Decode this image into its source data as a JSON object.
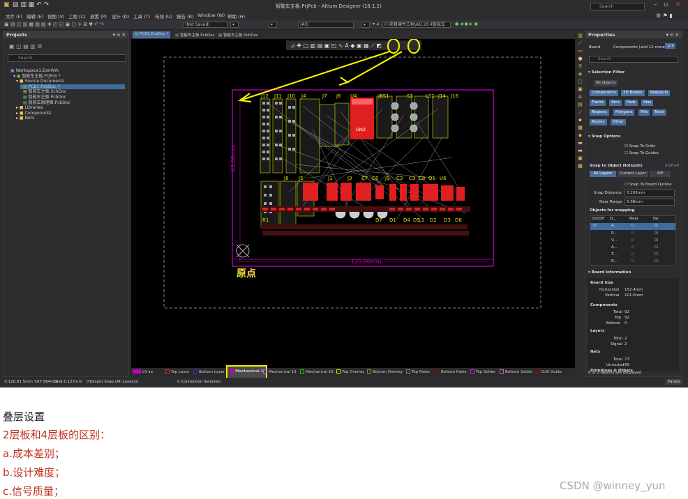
{
  "app": {
    "title": "智能车主板.PrjPcb - Altium Designer (18.1.2)",
    "search": "Search"
  },
  "menu": [
    "文件 (F)",
    "编辑 (E)",
    "视图 (V)",
    "工程 (C)",
    "放置 (P)",
    "设计 (D)",
    "工具 (T)",
    "布线 (U)",
    "报告 (R)",
    "Window (W)",
    "帮助 (H)"
  ],
  "toolbar": {
    "not_saved": "(Not Saved)",
    "all": "(All)",
    "path": "F:\\项目硬件工程\\AD 20.4智能车主板"
  },
  "projects": {
    "title": "Projects",
    "search": "Search",
    "tree": [
      "Workspace1.DsnWrk",
      "智能车主板.PrjPcb *",
      "Source Documents",
      "PCB1.PcbDoc *",
      "智能车主板.SchDoc",
      "智能车主板.PcbDoc",
      "智能车原理图.PcbDoc",
      "Libraries",
      "Components",
      "Nets"
    ]
  },
  "doc_tabs": [
    "PCB1.PcbDoc *",
    "智能车主板.PcbDoc",
    "智能车主板.SchDoc"
  ],
  "pcb": {
    "origin_label": "原点",
    "dim_h": "120.00mm",
    "dim_v": "65.00mm",
    "designators": [
      "J12",
      "J11",
      "J10",
      "J4",
      "J7",
      "J6",
      "U4",
      "JBS1",
      "S3",
      "LS1",
      "J14",
      "J16",
      "J8",
      "J5",
      "J1",
      "J3",
      "C7",
      "C6",
      "J9",
      "C3",
      "C9",
      "C8",
      "Q1",
      "U6",
      "D1",
      "D4",
      "D2",
      "D3",
      "D6",
      "D5",
      "R1",
      "L1",
      "D7",
      "GND"
    ]
  },
  "layers": [
    "LS",
    "Top Layer",
    "Bottom Layer",
    "Mechanical 1",
    "Mechanical 13",
    "Mechanical 15",
    "Top Overlay",
    "Bottom Overlay",
    "Top Paste",
    "Bottom Paste",
    "Top Solder",
    "Bottom Solder",
    "Drill Guide"
  ],
  "layer_colors": [
    "#c000c0",
    "#e02020",
    "#2030e0",
    "#c000c0",
    "#b060ff",
    "#20c020",
    "#e0e000",
    "#b08030",
    "#808080",
    "#a00000",
    "#c030c0",
    "#d060d0",
    "#a00000"
  ],
  "status": {
    "coords": "X:120.01.5mm Y:67.564mm",
    "grid": "Grid:0.127mm",
    "snap": "(Hotspot Snap (All Layers))",
    "conn": "0 Connection Selected"
  },
  "properties": {
    "title": "Properties",
    "board": "Board",
    "components_sel": "Components (and 12 more)",
    "search": "Search",
    "selection_filter": "Selection Filter",
    "all_objects": "All objects",
    "filters": [
      "Components",
      "3D Bodies",
      "Keepouts",
      "Tracks",
      "Arcs",
      "Pads",
      "Vias",
      "Regions",
      "Polygons",
      "Fills",
      "Texts",
      "Rooms",
      "Other"
    ],
    "snap_options": "Snap Options",
    "snap_grids": "Snap To Grids",
    "snap_guides": "Snap To Guides",
    "snap_hotspots": "Snap to Object Hotspots",
    "shortcut": "Shift+E",
    "snap_modes": [
      "All Layers",
      "Current Layer",
      "Off"
    ],
    "snap_board_outline": "Snap To Board Outline",
    "snap_distance_label": "Snap Distance",
    "snap_distance": "0.203mm",
    "near_range_label": "Near Range",
    "near_range": "5.08mm",
    "objects_for_snapping": "Objects for snapping",
    "table_head": [
      "On/Off",
      "O...",
      "Near",
      "Far"
    ],
    "table_rows": [
      "A...",
      "P...",
      "V...",
      "A...",
      "T...",
      "R..."
    ],
    "board_info": "Board Information",
    "board_size": "Board Size",
    "horizontal_label": "Horizontal",
    "horizontal": "152.4mm",
    "vertical_label": "Vertical",
    "vertical": "101.6mm",
    "components": "Components",
    "comp_total_label": "Total",
    "comp_total": "92",
    "comp_top_label": "Top",
    "comp_top": "92",
    "comp_bottom_label": "Bottom",
    "comp_bottom": "0",
    "layers": "Layers",
    "layers_total_label": "Total",
    "layers_total": "2",
    "layers_signal_label": "Signal",
    "layers_signal": "2",
    "nets": "Nets",
    "nets_total_label": "Total",
    "nets_total": "73",
    "nets_unrouted_label": "Unrouted",
    "nets_unrouted": "69",
    "primitives": "Primitives & Others",
    "footer": "0 of 1 objects are displayed",
    "panels": "Panels"
  },
  "article": {
    "heading": "叠层设置",
    "subheading": "2层板和4层板的区别：",
    "items": [
      "a.成本差别；",
      "b.设计难度；",
      "c.信号质量；"
    ],
    "watermark": "CSDN @winney_yun"
  }
}
